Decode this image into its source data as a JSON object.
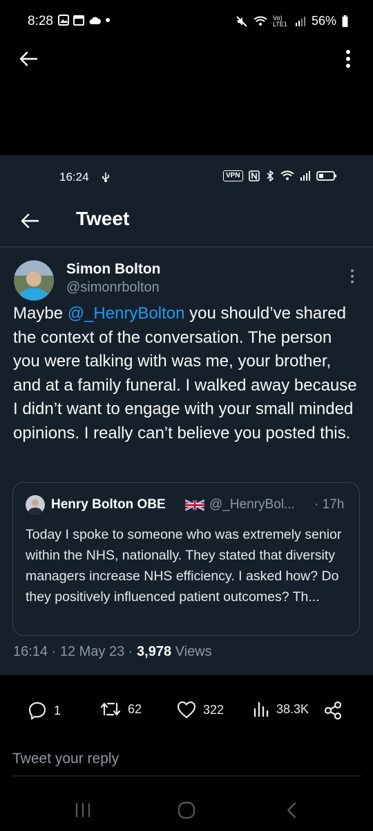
{
  "outer_status": {
    "time": "8:28",
    "battery": "56%",
    "network": "Vo) LTE1"
  },
  "inner_status": {
    "time": "16:24",
    "vpn": "VPN"
  },
  "header": {
    "title": "Tweet"
  },
  "tweet": {
    "author_name": "Simon Bolton",
    "author_handle": "@simonrbolton",
    "text_before": "Maybe ",
    "mention": "@_HenryBolton",
    "text_after": " you should’ve shared the context of the conversation. The person you were talking with was me, your brother, and at a family funeral. I walked away because I didn’t want to engage with your small minded opinions. I really can’t believe you posted this.",
    "time": "16:14",
    "date": "12 May 23",
    "views_count": "3,978",
    "views_label": "Views"
  },
  "quoted_tweet": {
    "author_name": "Henry Bolton OBE",
    "author_handle": "@_HenryBol...",
    "time": "· 17h",
    "text": "Today I spoke to someone who was extremely senior within the NHS, nationally. They stated that diversity managers increase NHS efficiency. I asked how? Do they positively influenced patient outcomes? Th..."
  },
  "actions": {
    "replies": "1",
    "retweets": "62",
    "likes": "322",
    "views": "38.3K"
  },
  "reply": {
    "placeholder": "Tweet your reply"
  },
  "colors": {
    "background": "#15202b",
    "accent": "#1d9bf0",
    "secondary_text": "#8b98a5"
  },
  "icons": [
    "back-arrow-icon",
    "more-vertical-icon",
    "reply-icon",
    "retweet-icon",
    "like-icon",
    "views-icon",
    "share-icon",
    "recents-icon",
    "home-icon",
    "back-nav-icon"
  ]
}
